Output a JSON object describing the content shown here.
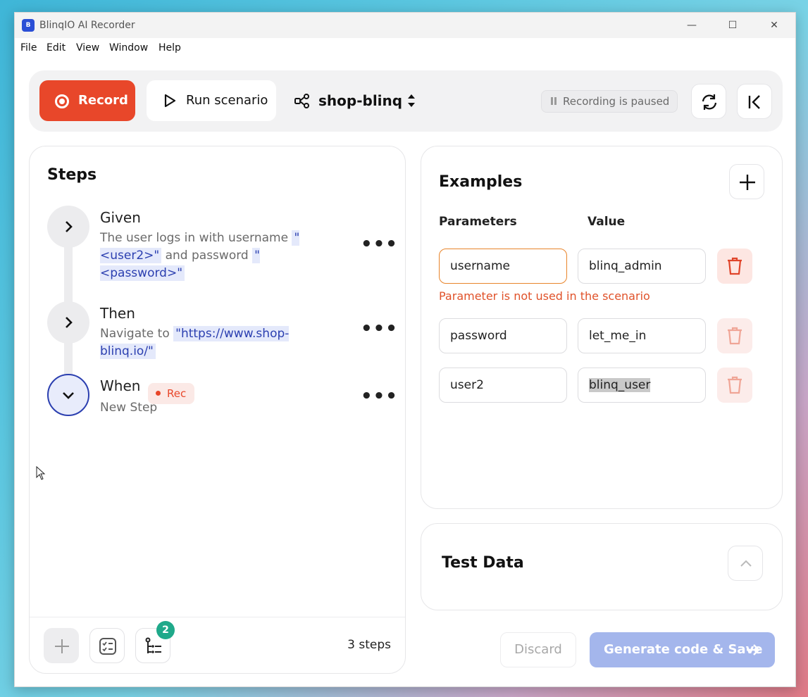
{
  "window": {
    "title": "BlinqIO AI Recorder",
    "logo_text": "B",
    "controls": {
      "minimize": "—",
      "maximize": "☐",
      "close": "✕"
    }
  },
  "menu": [
    "File",
    "Edit",
    "View",
    "Window",
    "Help"
  ],
  "toolbar": {
    "record_label": "Record",
    "run_label": "Run scenario",
    "project_name": "shop-blinq",
    "status": "Recording is paused",
    "record_color": "#e8472a"
  },
  "steps": {
    "title": "Steps",
    "items": [
      {
        "keyword": "Given",
        "text_parts": [
          "The user logs in with username ",
          "\"<user2>\"",
          " and password ",
          "\"<password>\""
        ],
        "state": "collapsed"
      },
      {
        "keyword": "Then",
        "text_parts": [
          "Navigate to ",
          "\"https://www.shop-blinq.io/\""
        ],
        "state": "collapsed"
      },
      {
        "keyword": "When",
        "badge": "Rec",
        "text": "New Step",
        "state": "expanded"
      }
    ],
    "footer": {
      "badge_count": "2",
      "count_label": "3 steps"
    }
  },
  "examples": {
    "title": "Examples",
    "columns": [
      "Parameters",
      "Value"
    ],
    "rows": [
      {
        "parameter": "username",
        "value": "blinq_admin",
        "error": "Parameter is not used in the scenario"
      },
      {
        "parameter": "password",
        "value": "let_me_in"
      },
      {
        "parameter": "user2",
        "value": "blinq_user"
      }
    ]
  },
  "test_data": {
    "title": "Test Data"
  },
  "actions": {
    "discard_label": "Discard",
    "generate_label": "Generate code & Save",
    "generate_color": "#a4b6ec"
  }
}
